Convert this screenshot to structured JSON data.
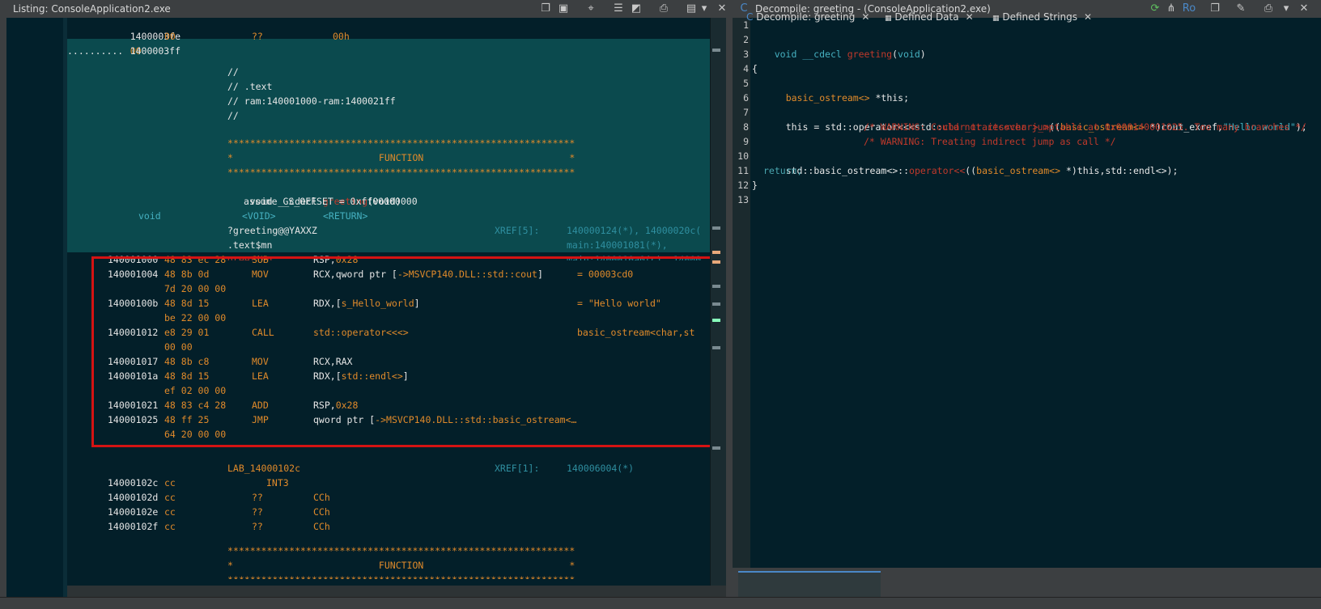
{
  "listing": {
    "title": "Listing:  ConsoleApplication2.exe",
    "lines": [
      {
        "addr": "1400003fe",
        "bytes": "00",
        "mn": "??",
        "op": "00h"
      },
      {
        "addr": "1400003ff",
        "bytes": "00",
        "mn": "??",
        "op": "00h"
      }
    ],
    "dots": "..........",
    "comment1": "//",
    "comment2": "// .text",
    "comment3": "// ram:140001000-ram:1400021ff",
    "comment4": "//",
    "stars": "**************************************************************",
    "func_banner": "*                          FUNCTION                          *",
    "sig_prefix": "void __cdecl ",
    "sig_name": "greeting",
    "sig_suffix": "(void)",
    "assume": "assume GS_OFFSET = 0xff00000000",
    "ret_type": "void",
    "ret_void": "<VOID>",
    "ret_return": "<RETURN>",
    "mangled": "?greeting@@YAXXZ",
    "xref5_label": "XREF[5]:",
    "xref5_a": "140000124(*), 14000020c(",
    "text_mn": ".text$mn",
    "xref5_b": "main:140001081(*),",
    "greeting_label": "greeting",
    "xref5_c": "main:1400010a0(c), 14000",
    "instrs": [
      {
        "addr": "140001000",
        "bytes": "48 83 ec 28",
        "mn": "SUB",
        "op_a": "RSP,",
        "op_b": "0x28",
        "cmt": ""
      },
      {
        "addr": "140001004",
        "bytes": "48 8b 0d",
        "mn": "MOV",
        "op_a": "RCX,qword ptr [",
        "op_b": "->MSVCP140.DLL::std::cout",
        "op_c": "]",
        "cmt": "= 00003cd0"
      },
      {
        "addr": "",
        "bytes": "7d 20 00 00",
        "mn": "",
        "op_a": "",
        "op_b": "",
        "cmt": ""
      },
      {
        "addr": "14000100b",
        "bytes": "48 8d 15",
        "mn": "LEA",
        "op_a": "RDX,[",
        "op_b": "s_Hello_world",
        "op_c": "]",
        "cmt": "= \"Hello world\""
      },
      {
        "addr": "",
        "bytes": "be 22 00 00",
        "mn": "",
        "op_a": "",
        "op_b": "",
        "cmt": ""
      },
      {
        "addr": "140001012",
        "bytes": "e8 29 01",
        "mn": "CALL",
        "op_a": "",
        "op_b": "std::operator<<<>",
        "cmt": "basic_ostream<char,st"
      },
      {
        "addr": "",
        "bytes": "00 00",
        "mn": "",
        "op_a": "",
        "op_b": "",
        "cmt": ""
      },
      {
        "addr": "140001017",
        "bytes": "48 8b c8",
        "mn": "MOV",
        "op_a": "RCX,RAX",
        "op_b": "",
        "cmt": ""
      },
      {
        "addr": "14000101a",
        "bytes": "48 8d 15",
        "mn": "LEA",
        "op_a": "RDX,[",
        "op_b": "std::endl<>",
        "op_c": "]",
        "cmt": ""
      },
      {
        "addr": "",
        "bytes": "ef 02 00 00",
        "mn": "",
        "op_a": "",
        "op_b": "",
        "cmt": ""
      },
      {
        "addr": "140001021",
        "bytes": "48 83 c4 28",
        "mn": "ADD",
        "op_a": "RSP,",
        "op_b": "0x28",
        "cmt": ""
      },
      {
        "addr": "140001025",
        "bytes": "48 ff 25",
        "mn": "JMP",
        "op_a": "qword ptr [",
        "op_b": "->MSVCP140.DLL::std::basic_ostream<…",
        "cmt": ""
      },
      {
        "addr": "",
        "bytes": "64 20 00 00",
        "mn": "",
        "op_a": "",
        "op_b": "",
        "cmt": ""
      }
    ],
    "lab": "LAB_14000102c",
    "xref1_label": "XREF[1]:",
    "xref1_val": "140006004(*)",
    "tail": [
      {
        "addr": "14000102c",
        "bytes": "cc",
        "mn": "INT3",
        "op": ""
      },
      {
        "addr": "14000102d",
        "bytes": "cc",
        "mn": "??",
        "op": "CCh"
      },
      {
        "addr": "14000102e",
        "bytes": "cc",
        "mn": "??",
        "op": "CCh"
      },
      {
        "addr": "14000102f",
        "bytes": "cc",
        "mn": "??",
        "op": "CCh"
      }
    ]
  },
  "decompile": {
    "title": "Decompile: greeting -  (ConsoleApplication2.exe)",
    "toolbar_ro": "Ro",
    "line_numbers": [
      "1",
      "2",
      "3",
      "4",
      "5",
      "6",
      "7",
      "8",
      "9",
      "10",
      "11",
      "12",
      "13"
    ],
    "l2_a": "void ",
    "l2_b": "__cdecl ",
    "l2_c": "greeting",
    "l2_d": "(",
    "l2_e": "void",
    "l2_f": ")",
    "l4": "{",
    "l5_a": "basic_ostream<> ",
    "l5_b": "*this;",
    "l7_a": "this = std::operator<<<std::",
    "l7_b": "char_traits<char>_>",
    "l7_c": "((",
    "l7_d": "basic_ostream<>",
    "l7_e": " *)cout_exref,",
    "l7_f": "\"Hello world\"",
    "l7_g": ");",
    "l8": "/* WARNING: Could not recover jumptable at 0x000140001025. Too many branches */",
    "l9": "/* WARNING: Treating indirect jump as call */",
    "l10_a": "std::basic_ostream<>::",
    "l10_b": "operator<<",
    "l10_c": "((",
    "l10_d": "basic_ostream<>",
    "l10_e": " *)this,std::endl<>);",
    "l11": "return;",
    "l12": "}"
  },
  "tabs": [
    {
      "label": "Decompile: greeting",
      "icon": "decompile-icon"
    },
    {
      "label": "Defined Data",
      "icon": "data-icon"
    },
    {
      "label": "Defined Strings",
      "icon": "data-icon"
    }
  ],
  "colors": {
    "highlight_box": "#d51313",
    "keyword": "#c0392b",
    "type": "#e08a2a",
    "string": "#45b0c0"
  }
}
